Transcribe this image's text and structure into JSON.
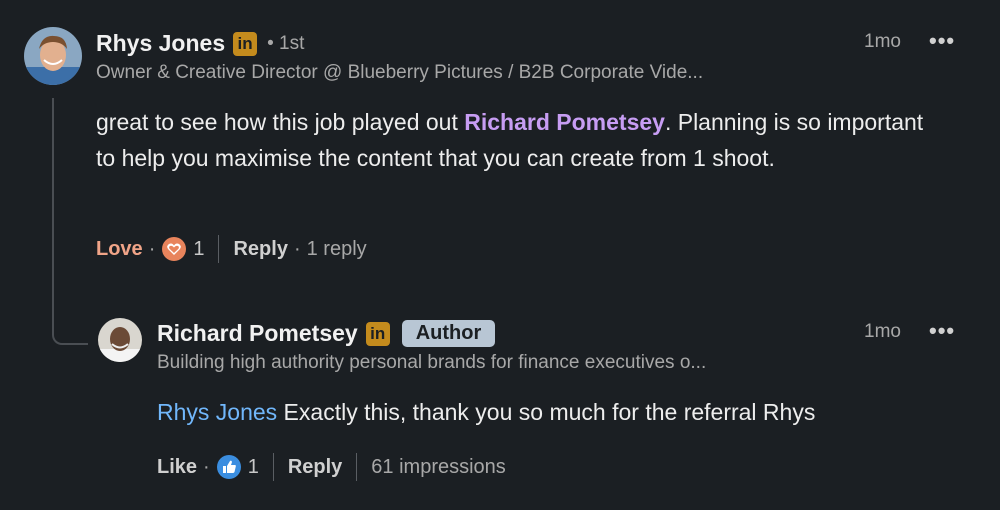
{
  "comment": {
    "author": "Rhys Jones",
    "degree": "• 1st",
    "headline": "Owner & Creative Director @ Blueberry Pictures / B2B Corporate Vide...",
    "timestamp": "1mo",
    "more": "•••",
    "text_before": "great to see how this job played out ",
    "mention": "Richard Pometsey",
    "text_after": ". Planning is so important to help you maximise the content that you can create from 1 shoot.",
    "reaction_label": "Love",
    "reaction_icon": "love-heart-icon",
    "reaction_count": "1",
    "reply_label": "Reply",
    "reply_count": "1 reply"
  },
  "reply": {
    "author": "Richard Pometsey",
    "badge": "Author",
    "headline": "Building high authority personal brands for finance executives o...",
    "timestamp": "1mo",
    "more": "•••",
    "mention": "Rhys Jones",
    "text_after": " Exactly this, thank you so much for the referral Rhys",
    "reaction_label": "Like",
    "reaction_icon": "like-thumb-icon",
    "reaction_count": "1",
    "reply_label": "Reply",
    "impressions": "61 impressions"
  },
  "linkedin_badge": "in",
  "colors": {
    "background": "#1b1f23",
    "linkedin_badge": "#c48b1d",
    "mention_purple": "#c79df3",
    "mention_blue": "#71b7fb",
    "love": "#f0a488",
    "author_badge": "#b8c6d4"
  }
}
